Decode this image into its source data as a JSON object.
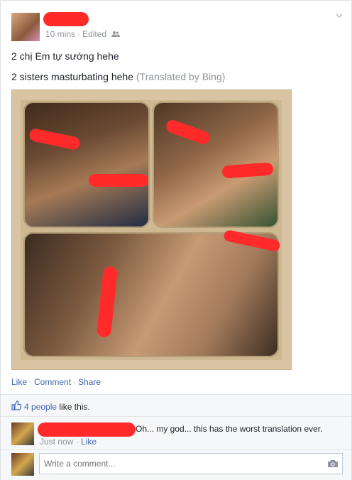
{
  "post": {
    "timestamp": "10 mins",
    "edited": "Edited",
    "audience_icon": "friends-icon",
    "original_text": "2 chị Em tự sướng hehe",
    "translated_text": "2 sisters masturbating hehe",
    "translation_note": "(Translated by Bing)"
  },
  "actions": {
    "like": "Like",
    "comment": "Comment",
    "share": "Share"
  },
  "likes": {
    "count_link": "4 people",
    "suffix": "like this."
  },
  "comment": {
    "text": "Oh... my god... this has the worst translation ever.",
    "time": "Just now",
    "like": "Like"
  },
  "composer": {
    "placeholder": "Write a comment..."
  },
  "colors": {
    "link": "#4267b2",
    "muted": "#90949c",
    "redaction": "#ff2b2b"
  }
}
